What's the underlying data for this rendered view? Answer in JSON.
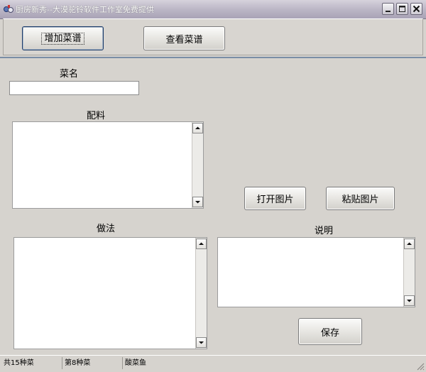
{
  "window": {
    "title": "厨房新秀--大漠驼铃软件工作室免费提供"
  },
  "toolbar": {
    "add_recipe_label": "增加菜谱",
    "view_recipe_label": "查看菜谱"
  },
  "form": {
    "dish_name_label": "菜名",
    "dish_name_value": "",
    "ingredients_label": "配料",
    "method_label": "做法",
    "description_label": "说明",
    "open_image_label": "打开图片",
    "paste_image_label": "粘贴图片",
    "save_label": "保存"
  },
  "statusbar": {
    "total": "共15种菜",
    "current": "第8种菜",
    "dish": "酸菜鱼"
  },
  "colors": {
    "titlebar": "#bcb7c6",
    "background": "#d6d3ce",
    "accent_line": "#7a8ea6"
  },
  "icons": {
    "app": "app-icon",
    "minimize": "minimize-icon",
    "maximize": "maximize-icon",
    "close": "close-icon",
    "scroll_up": "scroll-up-arrow-icon",
    "scroll_down": "scroll-down-arrow-icon",
    "resize": "resize-grip-icon"
  }
}
